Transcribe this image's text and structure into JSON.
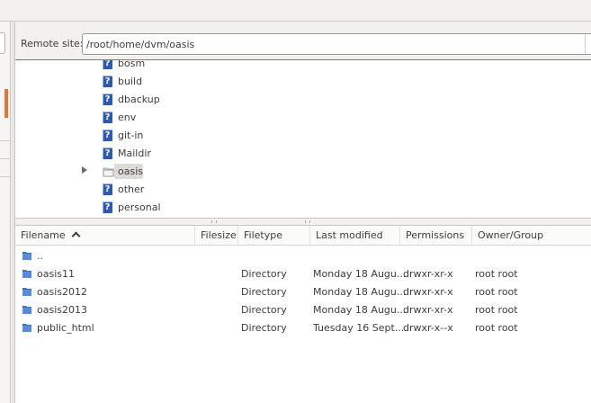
{
  "remote": {
    "label": "Remote site:",
    "path": "/root/home/dvm/oasis"
  },
  "tree": {
    "items": [
      {
        "label": "bosm",
        "icon": "question-folder-icon"
      },
      {
        "label": "build",
        "icon": "question-folder-icon"
      },
      {
        "label": "dbackup",
        "icon": "question-folder-icon"
      },
      {
        "label": "env",
        "icon": "question-folder-icon"
      },
      {
        "label": "git-in",
        "icon": "question-folder-icon"
      },
      {
        "label": "Maildir",
        "icon": "question-folder-icon"
      },
      {
        "label": "oasis",
        "icon": "folder-icon",
        "selected": true,
        "expandable": true
      },
      {
        "label": "other",
        "icon": "question-folder-icon"
      },
      {
        "label": "personal",
        "icon": "question-folder-icon"
      }
    ]
  },
  "filelist": {
    "columns": [
      "Filename",
      "Filesize",
      "Filetype",
      "Last modified",
      "Permissions",
      "Owner/Group"
    ],
    "rows": [
      {
        "name": "..",
        "size": "",
        "type": "",
        "modified": "",
        "perms": "",
        "owner": ""
      },
      {
        "name": "oasis11",
        "size": "",
        "type": "Directory",
        "modified": "Monday 18 Augu...",
        "perms": "drwxr-xr-x",
        "owner": "root root"
      },
      {
        "name": "oasis2012",
        "size": "",
        "type": "Directory",
        "modified": "Monday 18 Augu...",
        "perms": "drwxr-xr-x",
        "owner": "root root"
      },
      {
        "name": "oasis2013",
        "size": "",
        "type": "Directory",
        "modified": "Monday 18 Augu...",
        "perms": "drwxr-xr-x",
        "owner": "root root"
      },
      {
        "name": "public_html",
        "size": "",
        "type": "Directory",
        "modified": "Tuesday 16 Sept...",
        "perms": "drwxr-x--x",
        "owner": "root root"
      }
    ]
  },
  "colors": {
    "accent": "#e2733a",
    "folder": "#3d6fc4"
  }
}
